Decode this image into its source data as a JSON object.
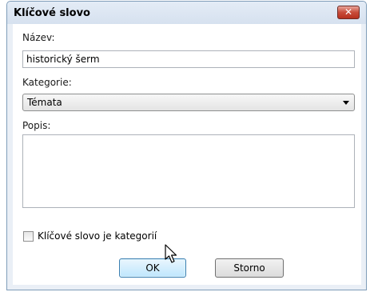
{
  "dialog": {
    "title": "Klíčové slovo",
    "close_icon": "close-icon"
  },
  "form": {
    "name_label": "Název:",
    "name_value": "historický šerm",
    "category_label": "Kategorie:",
    "category_value": "Témata",
    "description_label": "Popis:",
    "description_value": "",
    "is_category_label": "Klíčové slovo je kategorií",
    "is_category_checked": false
  },
  "buttons": {
    "ok_label": "OK",
    "cancel_label": "Storno"
  },
  "colors": {
    "close_button": "#c84c3a",
    "ok_button_border": "#3c7fb1"
  }
}
